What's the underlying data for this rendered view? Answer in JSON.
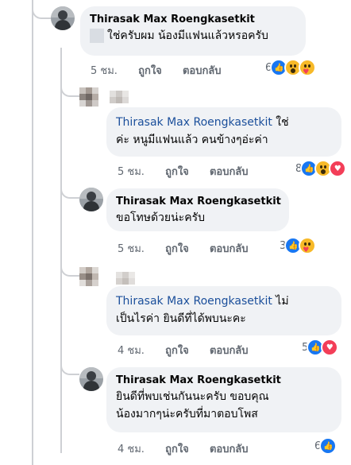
{
  "comments": [
    {
      "author": "Thirasak Max Roengkasetkit",
      "text": "ใช่ครับผม น้องมีแฟนแล้วหรอครับ",
      "time": "5 ชม.",
      "like": "ถูกใจ",
      "reply": "ตอบกลับ",
      "reaction_count": "6",
      "reactions": [
        "like-icon",
        "wow-icon",
        "care-icon"
      ]
    },
    {
      "mention": "Thirasak Max Roengkasetkit",
      "text_line1": "ใช่",
      "text_line2": "ค่ะ หนูมีแฟนแล้ว คนข้างๆอ่ะค่า",
      "time": "5 ชม.",
      "like": "ถูกใจ",
      "reply": "ตอบกลับ",
      "reaction_count": "8",
      "reactions": [
        "like-icon",
        "wow-icon",
        "love-icon"
      ]
    },
    {
      "author": "Thirasak Max Roengkasetkit",
      "text": "ขอโทษด้วยน่ะครับ",
      "time": "5 ชม.",
      "like": "ถูกใจ",
      "reply": "ตอบกลับ",
      "reaction_count": "3",
      "reactions": [
        "like-icon",
        "care-icon"
      ]
    },
    {
      "mention": "Thirasak Max Roengkasetkit",
      "text_line1": "ไม่",
      "text_line2": "เป็นไรค่า ยินดีที่ได้พบนะคะ",
      "time": "4 ชม.",
      "like": "ถูกใจ",
      "reply": "ตอบกลับ",
      "reaction_count": "5",
      "reactions": [
        "like-icon",
        "love-icon"
      ]
    },
    {
      "author": "Thirasak Max Roengkasetkit",
      "text_line1": "ยินดีที่พบเช่นกันนะครับ ขอบคุณ",
      "text_line2": "น้องมากๆน่ะครับที่มาตอบโพส",
      "time": "4 ชม.",
      "like": "ถูกใจ",
      "reply": "ตอบกลับ",
      "reaction_count": "6",
      "reactions": [
        "like-icon"
      ]
    }
  ],
  "colors": {
    "bubble": "#f0f2f5",
    "mention": "#1b4f9b",
    "meta": "#606770",
    "like": "#1877f2",
    "love": "#f33e58",
    "wow": "#f7b928"
  }
}
